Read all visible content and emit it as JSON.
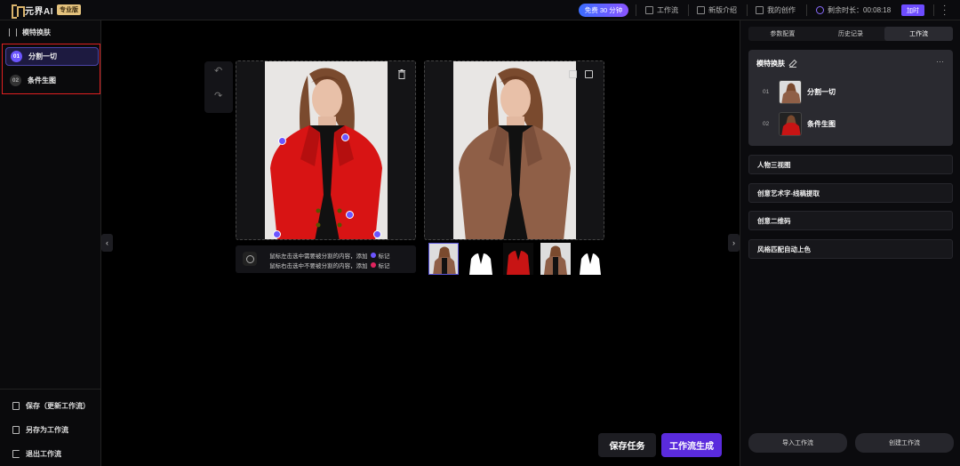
{
  "topbar": {
    "logo_text": "元界AI",
    "pro_badge": "专业版",
    "free_pill": "免费 30 分钟",
    "workflow": "工作流",
    "new_intro": "新版介绍",
    "my_creations": "我的创作",
    "remaining_label": "剩余时长：",
    "remaining_time": "00:08:18",
    "recharge": "加时"
  },
  "leftbar": {
    "title": "模特换肤",
    "steps": [
      {
        "num": "01",
        "label": "分割一切"
      },
      {
        "num": "02",
        "label": "条件生图"
      }
    ],
    "actions": {
      "save": "保存（更新工作流）",
      "save_as": "另存为工作流",
      "exit": "退出工作流"
    }
  },
  "hint": {
    "line1": "鼠标左击选中需要被分割的内容，添加",
    "line1_tag": "标记",
    "line2": "鼠标右击选中不要被分割的内容，添加",
    "line2_tag": "标记"
  },
  "buttons": {
    "save_task": "保存任务",
    "generate": "工作流生成"
  },
  "rightbar": {
    "tabs": [
      "参数配置",
      "历史记录",
      "工作流"
    ],
    "card_title": "模特换肤",
    "card_steps": [
      {
        "num": "01",
        "label": "分割一切"
      },
      {
        "num": "02",
        "label": "条件生图"
      }
    ],
    "workflows": [
      "人物三视图",
      "创意艺术字-线稿提取",
      "创意二维码",
      "风格匹配自动上色"
    ],
    "import": "导入工作流",
    "create": "创建工作流"
  },
  "colors": {
    "accent": "#6c55ff",
    "generate_button": "#5a2bdd",
    "highlight_border": "#e02020",
    "positive_marker": "#6c55ff",
    "negative_marker": "#e0245e"
  }
}
